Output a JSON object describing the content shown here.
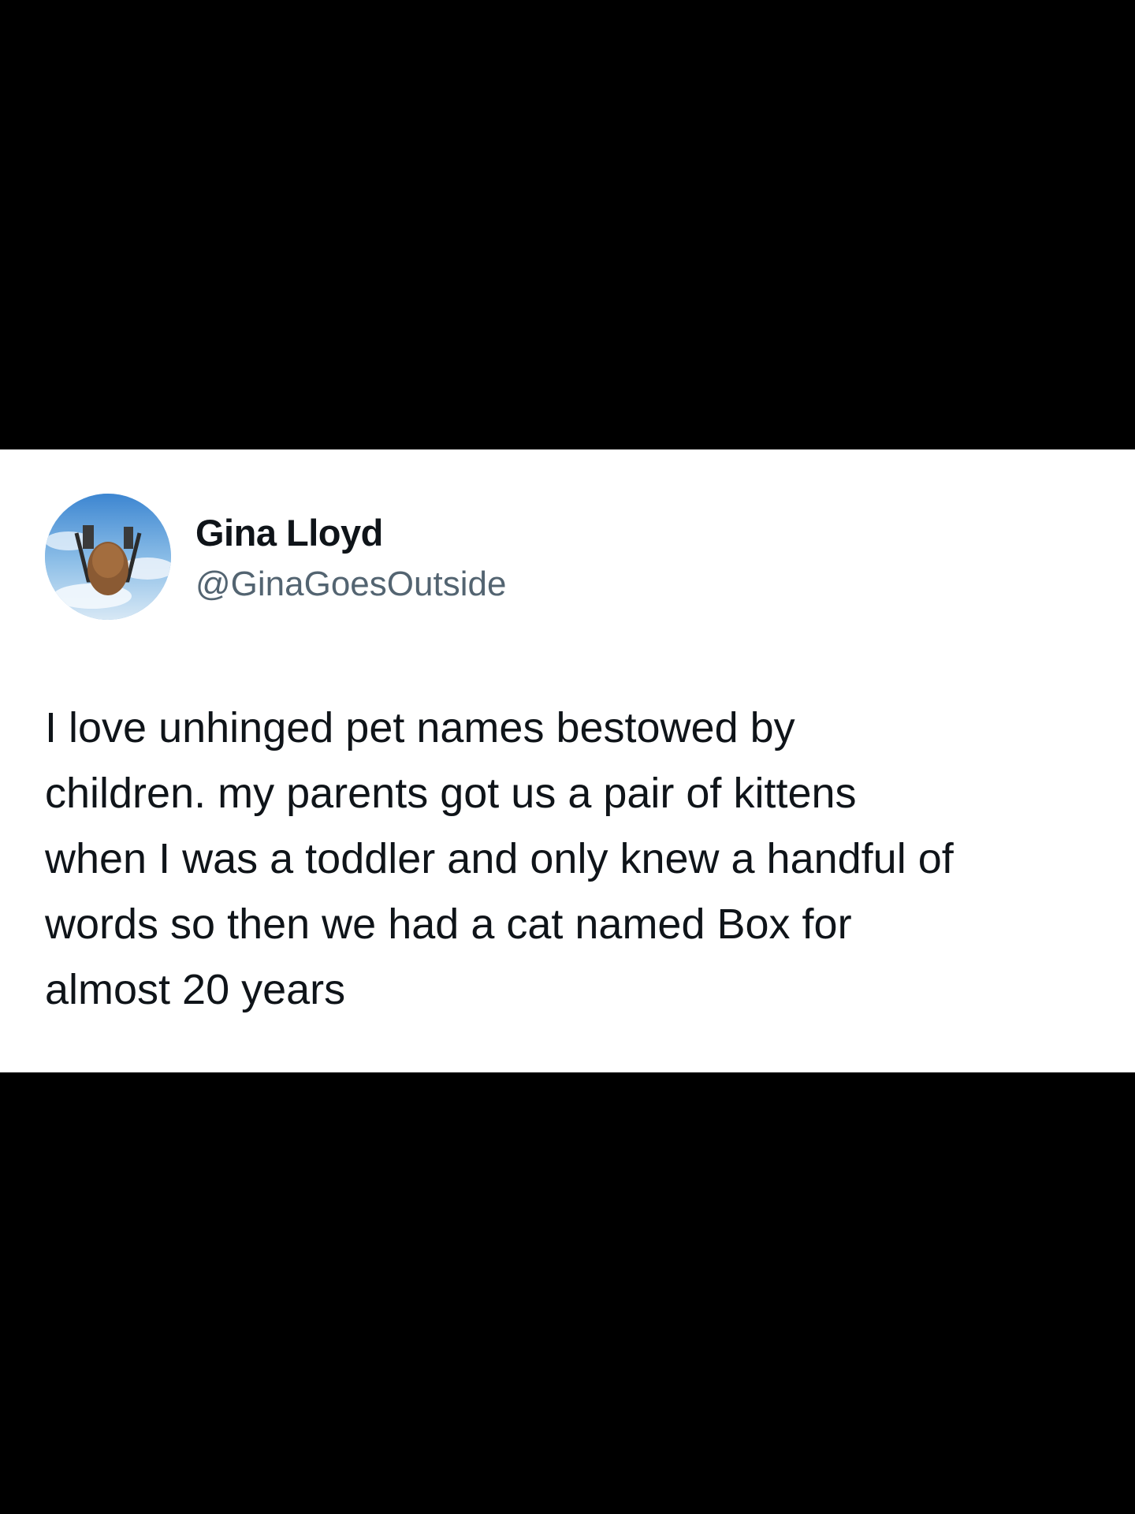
{
  "tweet": {
    "author": {
      "name": "Gina Lloyd",
      "handle": "@GinaGoesOutside",
      "avatar_icon": "profile-photo-avatar"
    },
    "text": "I love unhinged pet names bestowed by\nchildren. my parents got us a pair of kittens\nwhen I was a toddler and only knew a handful of\nwords so then we had a cat named Box for\nalmost 20 years"
  },
  "colors": {
    "background": "#000000",
    "card": "#ffffff",
    "name": "#0f1419",
    "handle": "#536471",
    "text": "#0f1419"
  }
}
